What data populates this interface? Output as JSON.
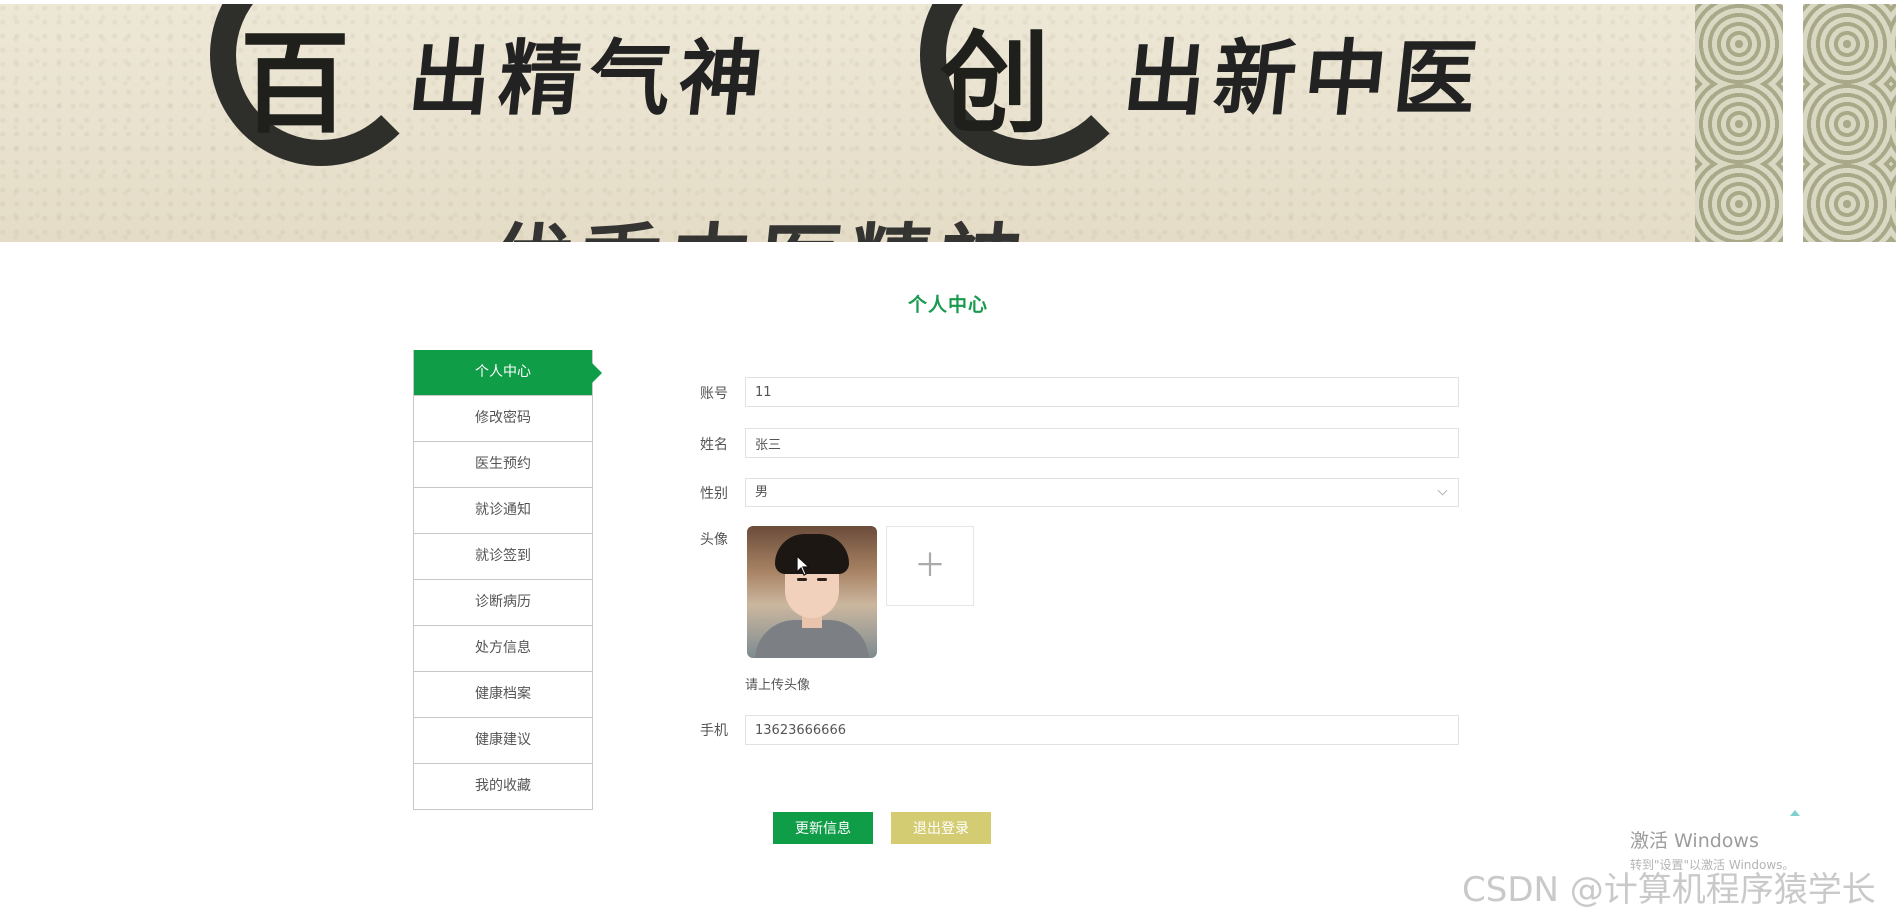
{
  "banner": {
    "glyph_left": "百",
    "slogan_left": "出精气神",
    "glyph_right": "创",
    "slogan_right": "出新中医",
    "slogan_bottom": "优秀中医精神"
  },
  "page": {
    "title": "个人中心"
  },
  "sidebar": {
    "items": [
      {
        "label": "个人中心",
        "active": true
      },
      {
        "label": "修改密码"
      },
      {
        "label": "医生预约"
      },
      {
        "label": "就诊通知"
      },
      {
        "label": "就诊签到"
      },
      {
        "label": "诊断病历"
      },
      {
        "label": "处方信息"
      },
      {
        "label": "健康档案"
      },
      {
        "label": "健康建议"
      },
      {
        "label": "我的收藏"
      }
    ]
  },
  "form": {
    "account": {
      "label": "账号",
      "value": "11"
    },
    "name": {
      "label": "姓名",
      "value": "张三"
    },
    "gender": {
      "label": "性别",
      "value": "男"
    },
    "avatar": {
      "label": "头像",
      "upload_icon": "plus-icon",
      "hint": "请上传头像"
    },
    "phone": {
      "label": "手机",
      "value": "13623666666"
    }
  },
  "actions": {
    "update": "更新信息",
    "logout": "退出登录"
  },
  "overlay": {
    "activate_title": "激活 Windows",
    "activate_sub": "转到\"设置\"以激活 Windows。",
    "watermark": "CSDN @计算机程序猿学长"
  },
  "colors": {
    "accent": "#0f9d48",
    "logout": "#d4cc72",
    "title": "#1a9a4e"
  }
}
